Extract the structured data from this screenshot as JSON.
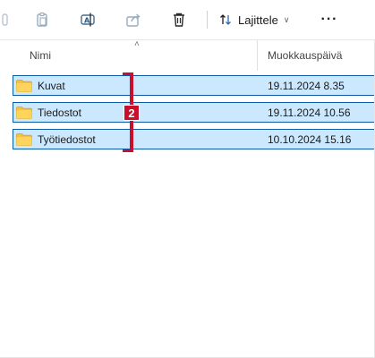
{
  "toolbar": {
    "buttons": [
      {
        "icon": "cut-icon",
        "enabled": false
      },
      {
        "icon": "paste-icon",
        "enabled": false
      },
      {
        "icon": "rename-icon",
        "enabled": true
      },
      {
        "icon": "share-icon",
        "enabled": true
      },
      {
        "icon": "delete-icon",
        "enabled": true
      }
    ],
    "sort_label": "Lajittele",
    "more_label": "···"
  },
  "columns": {
    "name": "Nimi",
    "date": "Muokkauspäivä"
  },
  "rows": [
    {
      "name": "Kuvat",
      "date": "19.11.2024 8.35"
    },
    {
      "name": "Tiedostot",
      "date": "19.11.2024 10.56"
    },
    {
      "name": "Työtiedostot",
      "date": "10.10.2024 15.16"
    }
  ],
  "annotation": {
    "badge_label": "2"
  },
  "colors": {
    "selection_bg": "#cce8ff",
    "selection_border": "#0b5ba8",
    "annotation": "#c8102e",
    "folder": "#f6c142"
  }
}
